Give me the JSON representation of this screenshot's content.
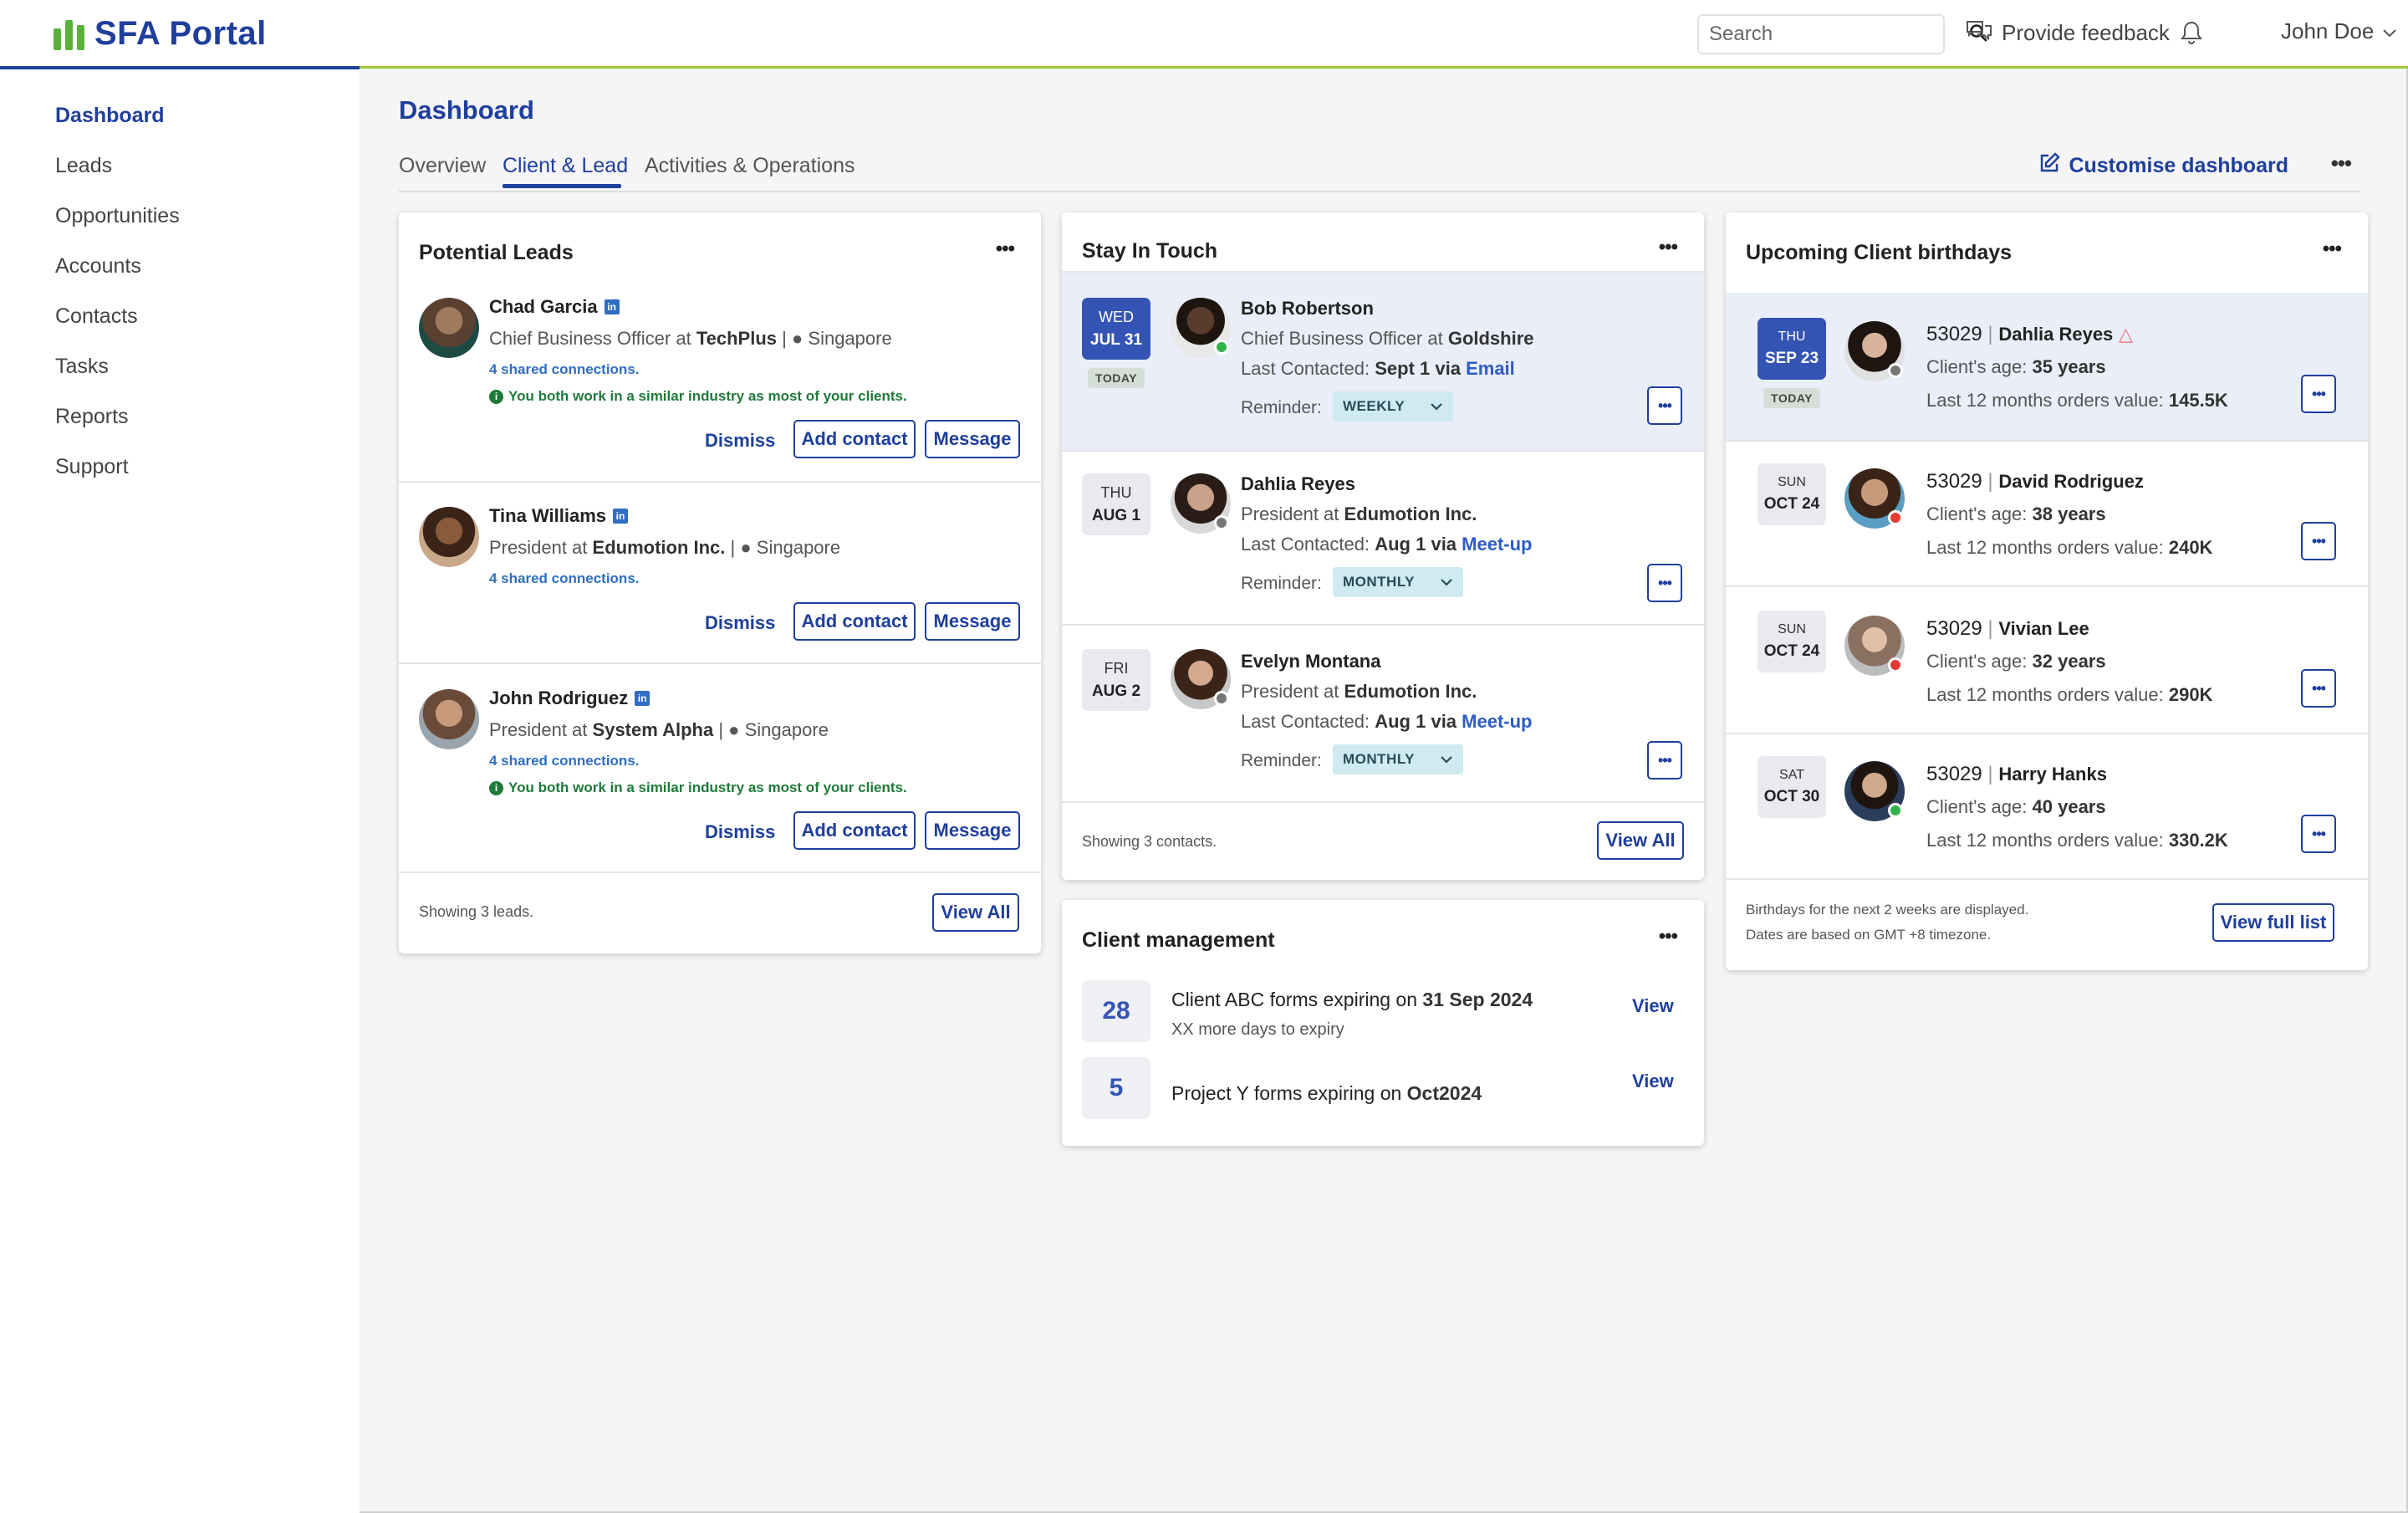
{
  "app": {
    "name": "SFA Portal"
  },
  "header": {
    "search_placeholder": "Search",
    "feedback_label": "Provide feedback",
    "user_name": "John Doe"
  },
  "sidebar": {
    "items": [
      {
        "label": "Dashboard",
        "active": true
      },
      {
        "label": "Leads"
      },
      {
        "label": "Opportunities"
      },
      {
        "label": "Accounts"
      },
      {
        "label": "Contacts"
      },
      {
        "label": "Tasks"
      },
      {
        "label": "Reports"
      },
      {
        "label": "Support"
      }
    ]
  },
  "page": {
    "title": "Dashboard",
    "tabs": [
      {
        "label": "Overview"
      },
      {
        "label": "Client & Lead",
        "active": true
      },
      {
        "label": "Activities & Operations"
      }
    ],
    "customise_label": "Customise dashboard"
  },
  "potential_leads": {
    "title": "Potential Leads",
    "dismiss_label": "Dismiss",
    "add_contact_label": "Add contact",
    "message_label": "Message",
    "leads": [
      {
        "name": "Chad Garcia",
        "role": "Chief Business Officer at",
        "company": "TechPlus",
        "location": "Singapore",
        "connections": "4 shared connections.",
        "similarity": "You both work in a similar industry as most of your clients."
      },
      {
        "name": "Tina Williams",
        "role": "President at",
        "company": "Edumotion Inc.",
        "location": "Singapore",
        "connections": "4 shared connections."
      },
      {
        "name": "John Rodriguez",
        "role": "President at",
        "company": "System Alpha",
        "location": "Singapore",
        "connections": "4 shared connections.",
        "similarity": "You both work in a similar industry as most of your clients."
      }
    ],
    "footer_text": "Showing 3 leads.",
    "view_all_label": "View All"
  },
  "stay_in_touch": {
    "title": "Stay In Touch",
    "reminder_label": "Reminder:",
    "today_label": "TODAY",
    "contacts": [
      {
        "day": "WED",
        "date": "JUL 31",
        "today": true,
        "name": "Bob Robertson",
        "role": "Chief Business Officer at",
        "company": "Goldshire",
        "last_contacted_prefix": "Last Contacted:",
        "last_contacted_date": "Sept 1 via",
        "channel": "Email",
        "reminder": "WEEKLY",
        "status_color": "#2fb34a"
      },
      {
        "day": "THU",
        "date": "AUG 1",
        "name": "Dahlia Reyes",
        "role": "President at",
        "company": "Edumotion Inc.",
        "last_contacted_prefix": "Last Contacted:",
        "last_contacted_date": "Aug 1 via",
        "channel": "Meet-up",
        "reminder": "MONTHLY",
        "status_color": "#777777"
      },
      {
        "day": "FRI",
        "date": "AUG 2",
        "name": "Evelyn Montana",
        "role": "President at",
        "company": "Edumotion Inc.",
        "last_contacted_prefix": "Last Contacted:",
        "last_contacted_date": "Aug 1 via",
        "channel": "Meet-up",
        "reminder": "MONTHLY",
        "status_color": "#777777"
      }
    ],
    "footer_text": "Showing 3 contacts.",
    "view_all_label": "View All"
  },
  "client_management": {
    "title": "Client management",
    "items": [
      {
        "count": "28",
        "text": "Client ABC forms expiring on",
        "date": "31 Sep 2024",
        "subtext": "XX more days to expiry",
        "action": "View"
      },
      {
        "count": "5",
        "text": "Project Y forms expiring on",
        "date": "Oct2024",
        "action": "View"
      }
    ]
  },
  "birthdays": {
    "title": "Upcoming Client birthdays",
    "today_label": "TODAY",
    "age_prefix": "Client's age:",
    "orders_prefix": "Last 12 months orders value:",
    "clients": [
      {
        "day": "THU",
        "date": "SEP 23",
        "today": true,
        "id": "53029",
        "name": "Dahlia Reyes",
        "age": "35 years",
        "orders": "145.5K",
        "status_color": "#777777"
      },
      {
        "day": "SUN",
        "date": "OCT 24",
        "id": "53029",
        "name": "David Rodriguez",
        "age": "38 years",
        "orders": "240K",
        "status_color": "#e53935"
      },
      {
        "day": "SUN",
        "date": "OCT 24",
        "id": "53029",
        "name": "Vivian Lee",
        "age": "32 years",
        "orders": "290K",
        "status_color": "#e53935"
      },
      {
        "day": "SAT",
        "date": "OCT 30",
        "id": "53029",
        "name": "Harry Hanks",
        "age": "40 years",
        "orders": "330.2K",
        "status_color": "#2fb34a"
      }
    ],
    "footer_line1": "Birthdays for the next 2 weeks are displayed.",
    "footer_line2": "Dates are based on GMT +8 timezone.",
    "view_full_label": "View full list"
  },
  "colors": {
    "brand_blue": "#1f3f9c",
    "accent_green": "#9cc93c",
    "today_blue": "#3454b4",
    "highlight_row": "#e9eef8"
  }
}
